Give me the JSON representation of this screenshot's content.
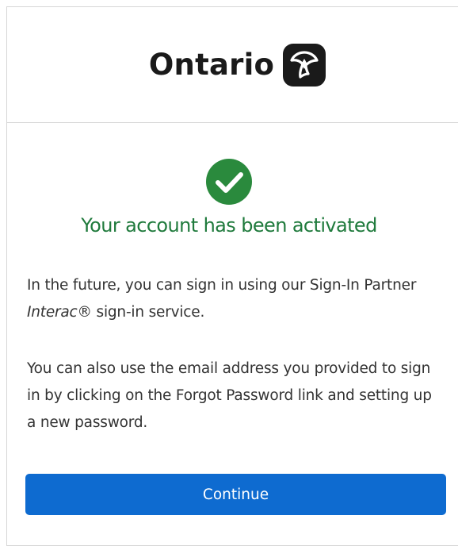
{
  "header": {
    "logo_text": "Ontario",
    "logo_icon": "trillium-icon"
  },
  "status": {
    "icon": "check-circle-icon",
    "icon_color": "#2a8a3d",
    "title": "Your account has been activated",
    "title_color": "#1f7a3c"
  },
  "body": {
    "paragraph1_prefix": "In the future, you can sign in using our Sign-In Partner ",
    "paragraph1_italic": "Interac",
    "paragraph1_suffix": "® sign-in service.",
    "paragraph2": "You can also use the email address you provided to sign in by clicking on the Forgot Password link and setting up a new password."
  },
  "actions": {
    "continue_label": "Continue",
    "continue_color": "#0e6bd0"
  }
}
